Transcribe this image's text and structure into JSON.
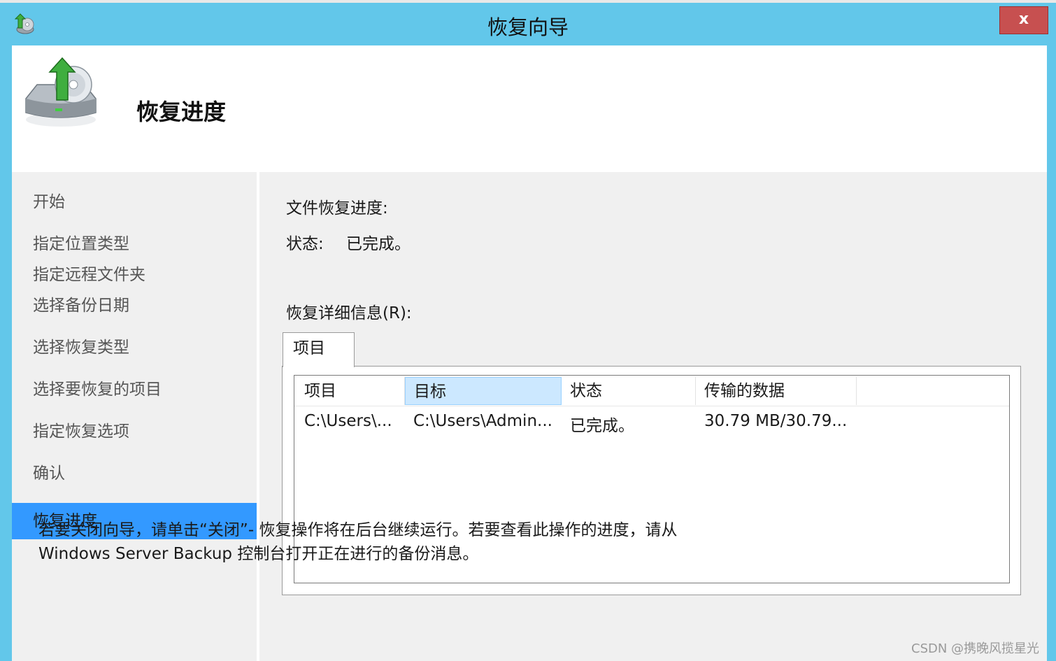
{
  "window": {
    "title": "恢复向导",
    "close_label": "x"
  },
  "header": {
    "title": "恢复进度"
  },
  "sidebar": {
    "items": [
      {
        "label": "开始"
      },
      {
        "label": "指定位置类型"
      },
      {
        "label": "指定远程文件夹"
      },
      {
        "label": "选择备份日期"
      },
      {
        "label": "选择恢复类型"
      },
      {
        "label": "选择要恢复的项目"
      },
      {
        "label": "指定恢复选项"
      },
      {
        "label": "确认"
      },
      {
        "label": "恢复进度"
      }
    ],
    "active_item": "恢复进度"
  },
  "main": {
    "progress_label": "文件恢复进度:",
    "status_label": "状态:",
    "status_value": "已完成。",
    "details_label": "恢复详细信息(R):",
    "tab_label": "项目",
    "columns": [
      "项目",
      "目标",
      "状态",
      "传输的数据"
    ],
    "rows": [
      [
        "C:\\Users\\...",
        "C:\\Users\\Admin...",
        "已完成。",
        "30.79 MB/30.79..."
      ]
    ],
    "footer_line1": "若要关闭向导，请单击“关闭”- 恢复操作将在后台继续运行。若要查看此操作的进度，请从",
    "footer_line2": "Windows Server Backup 控制台打开正在进行的备份消息。"
  },
  "watermark": "CSDN @携晚风揽星光",
  "colors": {
    "titlebar": "#62c7ea",
    "active_nav": "#3399ff",
    "close_button": "#c75050",
    "selected_header": "#cce8ff"
  },
  "icons": {
    "app": "backup-restore-icon",
    "header": "drive-restore-arrow-icon",
    "close": "close-icon"
  }
}
